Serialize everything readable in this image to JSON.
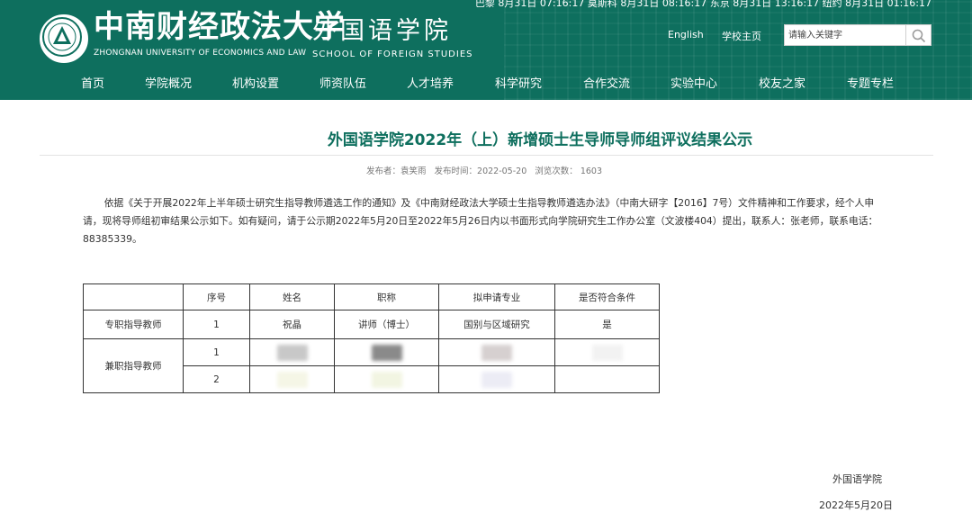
{
  "header": {
    "clock": "巴黎 8月31日 07:16:17 莫斯科 8月31日 08:16:17 东京 8月31日 13:16:17 纽约 8月31日 01:16:17",
    "logo_cn": "中南财经政法大学",
    "logo_en": "ZHONGNAN UNIVERSITY OF ECONOMICS AND LAW",
    "school_cn": "外国语学院",
    "school_en": "SCHOOL OF FOREIGN STUDIES",
    "link_english": "English",
    "link_home": "学校主页",
    "search_placeholder": "请输入关键字",
    "search_icon": "search-icon",
    "brand_color": "#0e6f5e"
  },
  "nav": [
    {
      "label": "首页"
    },
    {
      "label": "学院概况"
    },
    {
      "label": "机构设置"
    },
    {
      "label": "师资队伍"
    },
    {
      "label": "人才培养"
    },
    {
      "label": "科学研究"
    },
    {
      "label": "合作交流"
    },
    {
      "label": "实验中心"
    },
    {
      "label": "校友之家"
    },
    {
      "label": "专题专栏"
    }
  ],
  "article": {
    "title": "外国语学院2022年（上）新增硕士生导师导师组评议结果公示",
    "meta": {
      "author": "发布者：袁笑雨",
      "date": "发布时间：2022-05-20",
      "views_label": "浏览次数：",
      "views": "1603"
    },
    "body": "依据《关于开展2022年上半年硕士研究生指导教师遴选工作的通知》及《中南财经政法大学硕士生指导教师遴选办法》（中南大研字【2016】7号）文件精神和工作要求，经个人申请，现将导师组初审结果公示如下。如有疑问，请于公示期2022年5月20日至2022年5月26日内以书面形式向学院研究生工作办公室（文波楼404）提出，联系人：张老师，联系电话：88385339。"
  },
  "table": {
    "headers": [
      "",
      "序号",
      "姓名",
      "职称",
      "拟申请专业",
      "是否符合条件"
    ],
    "group_fulltime": "专职指导教师",
    "row1": {
      "index": "1",
      "name": "祝晶",
      "title": "讲师（博士）",
      "major": "国别与区域研究",
      "eligible": "是"
    },
    "group_parttime": "兼职指导教师",
    "row2": {
      "index": "1"
    },
    "row3": {
      "index": "2"
    }
  },
  "footer": {
    "school": "外国语学院",
    "date": "2022年5月20日"
  }
}
